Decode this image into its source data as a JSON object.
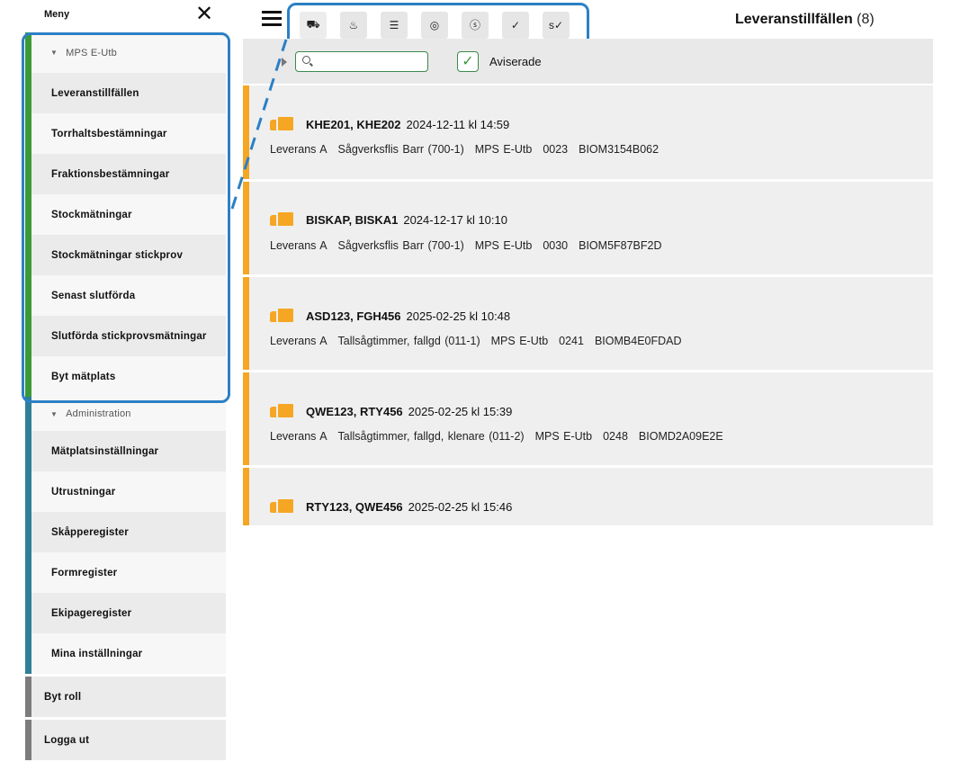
{
  "sidebar": {
    "title": "Meny",
    "close_label": "✕",
    "groups": [
      {
        "label": "MPS E-Utb",
        "items": [
          "Leveranstillfällen",
          "Torrhaltsbestämningar",
          "Fraktionsbestämningar",
          "Stockmätningar",
          "Stockmätningar stickprov",
          "Senast slutförda",
          "Slutförda stickprovsmätningar",
          "Byt mätplats"
        ]
      },
      {
        "label": "Administration",
        "items": [
          "Mätplatsinställningar",
          "Utrustningar",
          "Skåpperegister",
          "Formregister",
          "Ekipageregister",
          "Mina inställningar"
        ]
      }
    ],
    "footer_items": [
      "Byt roll",
      "Logga ut"
    ]
  },
  "toolbar": {
    "icons": [
      {
        "name": "truck-icon",
        "glyph": "⛟"
      },
      {
        "name": "heat-icon",
        "glyph": "♨"
      },
      {
        "name": "cabinet-icon",
        "glyph": "☰"
      },
      {
        "name": "log-end-icon",
        "glyph": "◎"
      },
      {
        "name": "coin-icon",
        "glyph": "ⓢ"
      },
      {
        "name": "truck-check-icon",
        "glyph": "✓"
      },
      {
        "name": "sample-check-icon",
        "glyph": "s✓"
      }
    ]
  },
  "page": {
    "title": "Leveranstillfällen",
    "count": "(8)"
  },
  "filter": {
    "search_placeholder": "",
    "search_value": "",
    "checkbox_checked": true,
    "checkbox_label": "Aviserade"
  },
  "deliveries": [
    {
      "vehicles": "KHE201, KHE202",
      "datetime": "2024-12-11 kl 14:59",
      "sub": [
        "Leverans A",
        "Sågverksflis Barr (700-1)",
        "MPS E-Utb",
        "0023",
        "BIOM3154B062"
      ]
    },
    {
      "vehicles": "BISKAP, BISKA1",
      "datetime": "2024-12-17 kl 10:10",
      "sub": [
        "Leverans A",
        "Sågverksflis Barr (700-1)",
        "MPS E-Utb",
        "0030",
        "BIOM5F87BF2D"
      ]
    },
    {
      "vehicles": "ASD123, FGH456",
      "datetime": "2025-02-25 kl 10:48",
      "sub": [
        "Leverans A",
        "Tallsågtimmer, fallgd (011-1)",
        "MPS E-Utb",
        "0241",
        "BIOMB4E0FDAD"
      ]
    },
    {
      "vehicles": "QWE123, RTY456",
      "datetime": "2025-02-25 kl 15:39",
      "sub": [
        "Leverans A",
        "Tallsågtimmer, fallgd, klenare (011-2)",
        "MPS E-Utb",
        "0248",
        "BIOMD2A09E2E"
      ]
    },
    {
      "vehicles": "RTY123, QWE456",
      "datetime": "2025-02-25 kl 15:46",
      "sub": []
    }
  ],
  "colors": {
    "accent_blue": "#2b80c5",
    "group_green": "#3b9a37",
    "group_teal": "#2f7f96",
    "delivery_orange": "#f5a623"
  }
}
